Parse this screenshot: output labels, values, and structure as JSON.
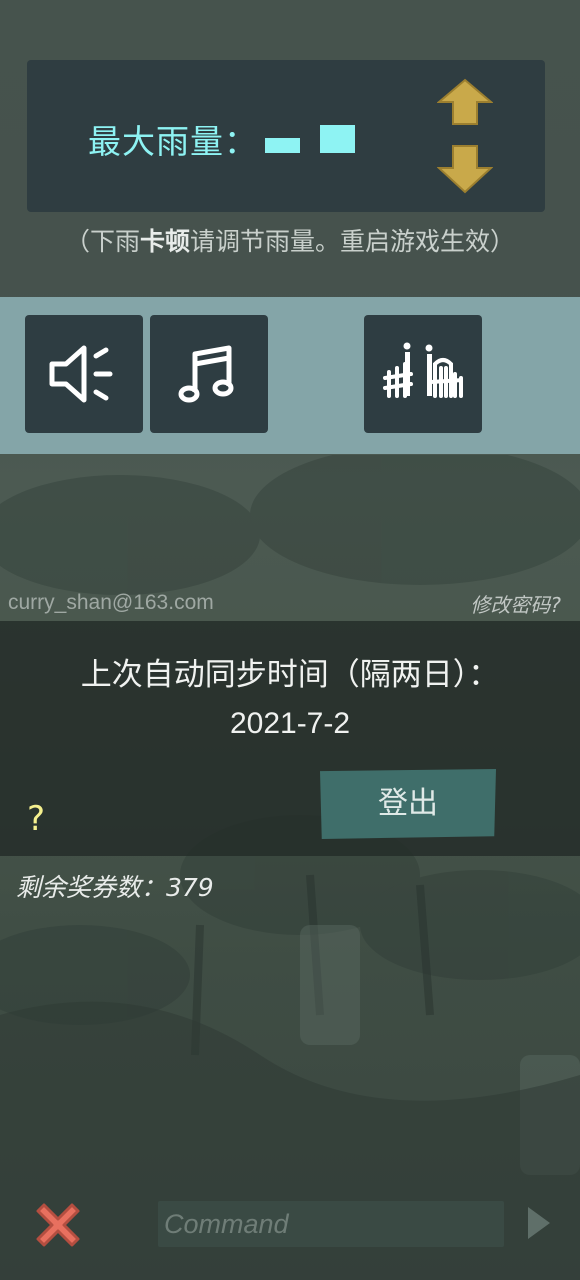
{
  "rain": {
    "label": "最大雨量：",
    "hint_prefix": "（下雨",
    "hint_bold": "卡顿",
    "hint_suffix": "请调节雨量。重启游戏生效）"
  },
  "icons": {
    "sound": "speaker-icon",
    "music": "music-note-icon",
    "fence": "fence-gate-icon"
  },
  "account": {
    "email": "curry_shan@163.com",
    "change_password": "修改密码?"
  },
  "sync": {
    "title": "上次自动同步时间（隔两日）：",
    "date": "2021-7-2",
    "logout_label": "登出",
    "help": "?"
  },
  "tickets": {
    "label": "剩余奖券数：379"
  },
  "command": {
    "placeholder": "Command"
  },
  "colors": {
    "accent_cyan": "#8ef3f3",
    "arrow_gold": "#c9a94a",
    "close_red": "#e8705f",
    "logout_teal": "#3f6e6a"
  }
}
